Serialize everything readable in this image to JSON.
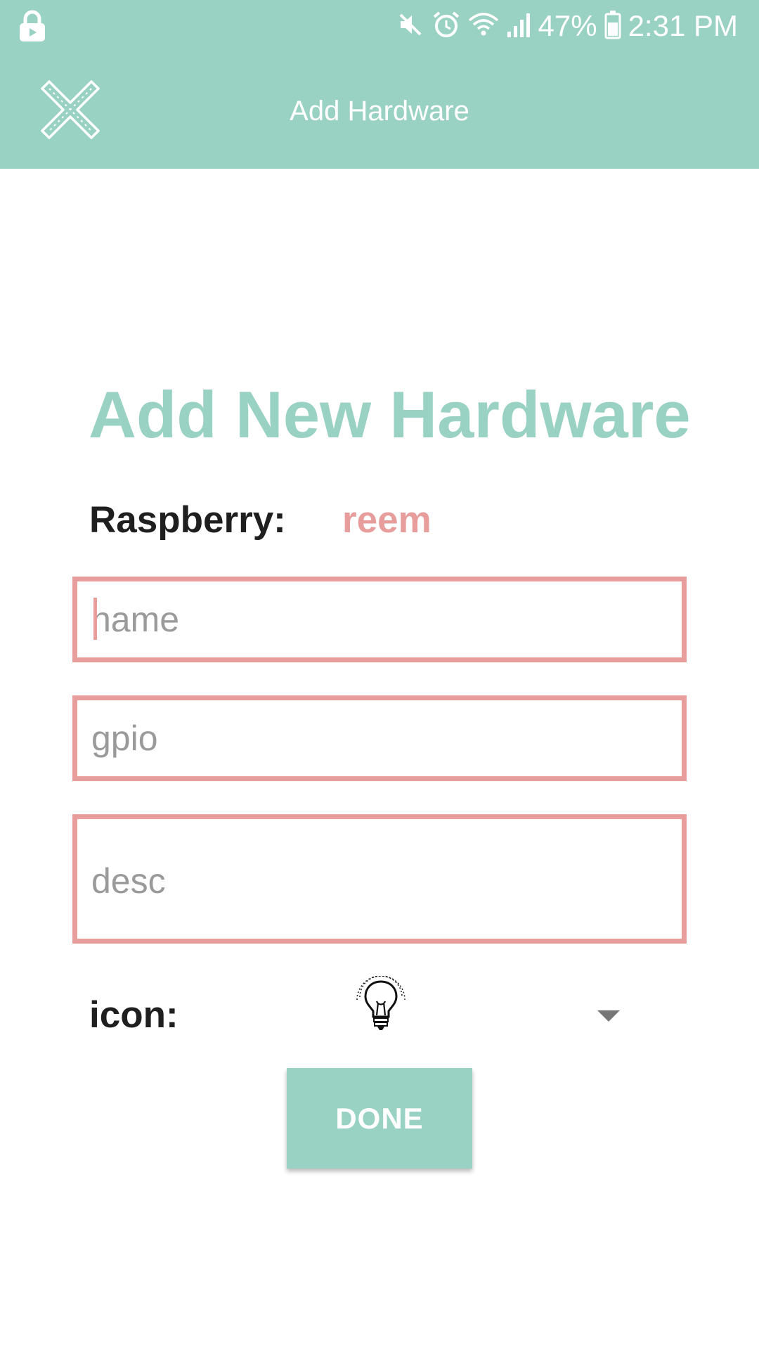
{
  "status_bar": {
    "battery_percent": "47%",
    "time": "2:31 PM",
    "icons": [
      "lock-icon",
      "mute-icon",
      "alarm-icon",
      "wifi-icon",
      "signal-icon",
      "battery-icon"
    ]
  },
  "toolbar": {
    "title": "Add Hardware",
    "close_icon": "close-icon"
  },
  "form": {
    "heading": "Add New Hardware",
    "raspberry_label": "Raspberry:",
    "raspberry_value": "reem",
    "name_placeholder": "name",
    "gpio_placeholder": "gpio",
    "desc_placeholder": "desc",
    "icon_label": "icon:",
    "selected_icon": "lightbulb-icon",
    "done_label": "DONE"
  },
  "colors": {
    "accent": "#99d1c2",
    "field_border": "#e89d9d",
    "text_dark": "#1f1f1f"
  }
}
